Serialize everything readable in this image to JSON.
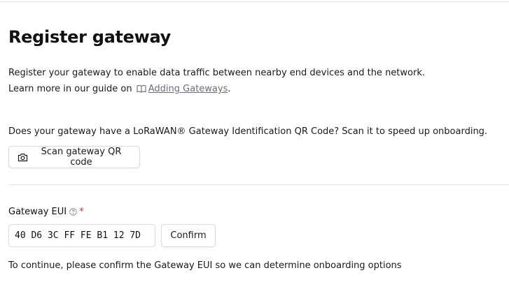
{
  "page": {
    "title": "Register gateway",
    "intro_line1": "Register your gateway to enable data traffic between nearby end devices and the network.",
    "intro_line2_prefix": "Learn more in our guide on",
    "guide_link_label": "Adding Gateways",
    "intro_line2_suffix": "."
  },
  "qr": {
    "question": "Does your gateway have a LoRaWAN® Gateway Identification QR Code? Scan it to speed up onboarding.",
    "scan_button_label": "Scan gateway QR code"
  },
  "gateway_eui": {
    "label": "Gateway EUI",
    "required_mark": "*",
    "value": "40 D6 3C FF FE B1 12 7D",
    "confirm_label": "Confirm",
    "hint": "To continue, please confirm the Gateway EUI so we can determine onboarding options"
  },
  "icons": {
    "book": "book-open-icon",
    "camera": "camera-icon",
    "help": "help-circle-icon"
  },
  "colors": {
    "link": "#6c6c7a",
    "required": "#d03030",
    "border": "#d9d9de"
  }
}
